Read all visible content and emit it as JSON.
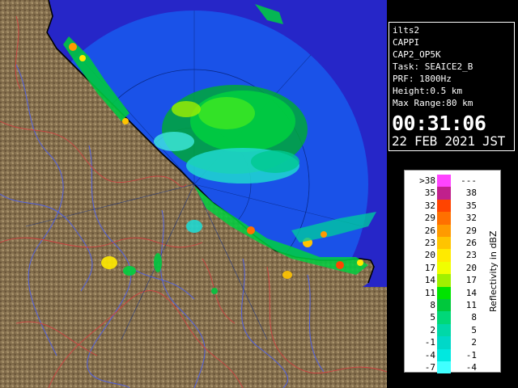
{
  "info_panel": {
    "site": "ilts2",
    "product": "CAPPI",
    "product_id": "CAP2_OP5K",
    "task": "Task: SEAICE2_B",
    "prf": "PRF: 1800Hz",
    "height": "Height:0.5 km",
    "max_range": "Max Range:80 km",
    "time": "00:31:06",
    "date": "22 FEB 2021 JST"
  },
  "legend": {
    "title": "Reflectivity in dBZ",
    "rows": [
      {
        "lo": ">38",
        "hi": "---",
        "color": "#ff44ff"
      },
      {
        "lo": "35",
        "hi": "38",
        "color": "#c0208c"
      },
      {
        "lo": "32",
        "hi": "35",
        "color": "#ff4400"
      },
      {
        "lo": "29",
        "hi": "32",
        "color": "#ff7000"
      },
      {
        "lo": "26",
        "hi": "29",
        "color": "#ff9a00"
      },
      {
        "lo": "23",
        "hi": "26",
        "color": "#ffc400"
      },
      {
        "lo": "20",
        "hi": "23",
        "color": "#ffea00"
      },
      {
        "lo": "17",
        "hi": "20",
        "color": "#f0ff00"
      },
      {
        "lo": "14",
        "hi": "17",
        "color": "#a0f000"
      },
      {
        "lo": "11",
        "hi": "14",
        "color": "#00e400"
      },
      {
        "lo": "8",
        "hi": "11",
        "color": "#00c83c"
      },
      {
        "lo": "5",
        "hi": "8",
        "color": "#00d878"
      },
      {
        "lo": "2",
        "hi": "5",
        "color": "#00d8a8"
      },
      {
        "lo": "-1",
        "hi": "2",
        "color": "#00d8c8"
      },
      {
        "lo": "-4",
        "hi": "-1",
        "color": "#00e8e0"
      },
      {
        "lo": "-7",
        "hi": "-4",
        "color": "#40ffff"
      }
    ]
  },
  "colors": {
    "sea": "#1a52e8",
    "outside": "#2a2acc",
    "land": "#8a7452",
    "coast": "#000000",
    "rivers": "#4a5ad8",
    "boundaries": "#d04040"
  }
}
